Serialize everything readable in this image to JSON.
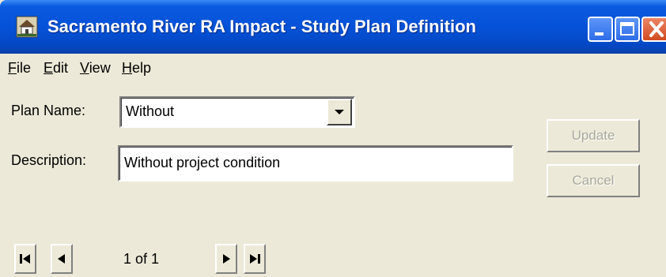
{
  "window": {
    "title": "Sacramento River RA Impact - Study Plan Definition"
  },
  "menu": {
    "items": [
      {
        "label": "File",
        "mnemonic": "F",
        "rest": "ile"
      },
      {
        "label": "Edit",
        "mnemonic": "E",
        "rest": "dit"
      },
      {
        "label": "View",
        "mnemonic": "V",
        "rest": "iew"
      },
      {
        "label": "Help",
        "mnemonic": "H",
        "rest": "elp"
      }
    ]
  },
  "form": {
    "plan_name_label": "Plan Name:",
    "plan_name_value": "Without",
    "description_label": "Description:",
    "description_value": "Without project condition"
  },
  "buttons": {
    "update_label": "Update",
    "cancel_label": "Cancel"
  },
  "navigator": {
    "record_text": "1 of 1"
  },
  "icons": [
    "window-app-icon",
    "minimize-icon",
    "maximize-icon",
    "close-icon",
    "dropdown-arrow-icon",
    "first-record-icon",
    "previous-record-icon",
    "next-record-icon",
    "last-record-icon"
  ],
  "colors": {
    "titlebar": "#0552d8",
    "close_button": "#d14a1f",
    "window_face": "#ece9d8",
    "disabled_text": "#a8a89a"
  }
}
